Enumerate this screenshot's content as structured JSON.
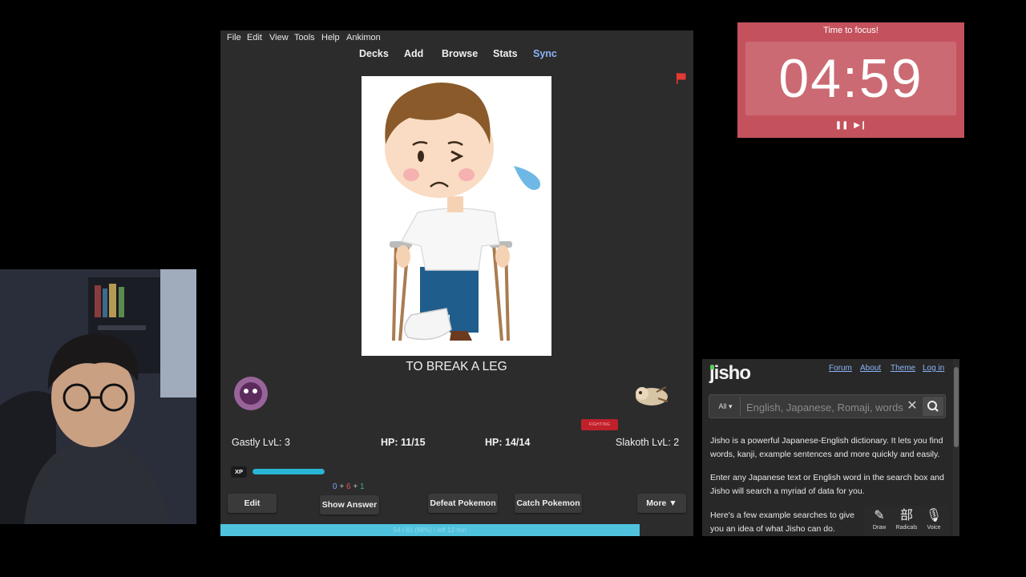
{
  "anki": {
    "menu": [
      "File",
      "Edit",
      "View",
      "Tools",
      "Help",
      "Ankimon"
    ],
    "nav": [
      "Decks",
      "Add",
      "Browse",
      "Stats",
      "Sync"
    ],
    "card_text": "TO BREAK A LEG",
    "fighting_badge": "FIGHTING",
    "player": {
      "name_level": "Gastly LvL: 3",
      "hp": "HP: 11/15"
    },
    "enemy": {
      "name_level": "Slakoth LvL: 2",
      "hp": "HP: 14/14"
    },
    "xp": {
      "label": "XP",
      "fraction": 1.0
    },
    "counts": {
      "new": "0",
      "plus1": "+",
      "learn": "6",
      "plus2": "+",
      "review": "1"
    },
    "buttons": {
      "edit": "Edit",
      "show_answer": "Show Answer",
      "defeat": "Defeat Pokemon",
      "catch": "Catch Pokemon",
      "more": "More ▼"
    },
    "progress": {
      "text": "54 / 61 (88%) | left 12 min",
      "fraction": 0.88
    },
    "colors": {
      "accent": "#8ab4f8",
      "flag": "#e53935",
      "progress": "#4fc2de"
    }
  },
  "timer": {
    "title": "Time to focus!",
    "time": "04:59",
    "pause": "❚❚",
    "skip": "▶❙",
    "color": "#c4525d"
  },
  "jisho": {
    "logo": "jisho",
    "links": [
      "Forum",
      "About",
      "Theme",
      "Log in"
    ],
    "search": {
      "scope": "All ▾",
      "placeholder": "English, Japanese, Romaji, words or text",
      "clear": "✕"
    },
    "paragraphs": [
      "Jisho is a powerful Japanese-English dictionary. It lets you find words, kanji, example sentences and more quickly and easily.",
      "Enter any Japanese text or English word in the search box and Jisho will search a myriad of data for you.",
      "Here's a few example searches to give you an idea of what Jisho can do."
    ],
    "tools": [
      {
        "icon": "✎",
        "label": "Draw"
      },
      {
        "icon": "部",
        "label": "Radicals"
      },
      {
        "icon": "🎙",
        "label": "Voice"
      }
    ]
  }
}
